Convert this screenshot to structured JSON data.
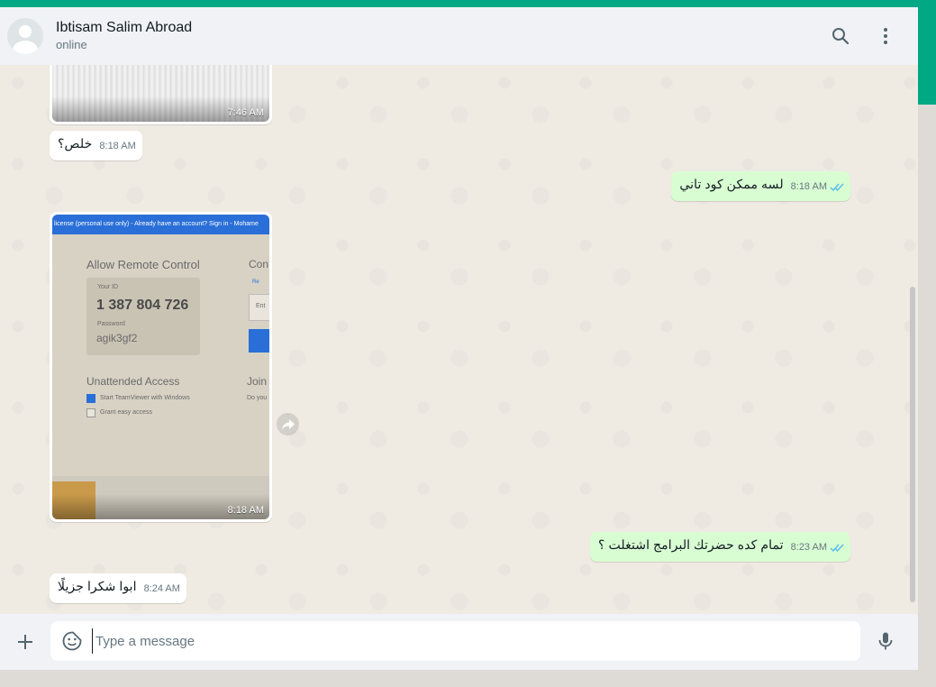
{
  "header": {
    "contact_name": "Ibtisam Salim Abroad",
    "contact_status": "online",
    "icons": [
      "avatar-icon",
      "search-icon",
      "menu-icon"
    ]
  },
  "messages": [
    {
      "type": "image",
      "direction": "incoming",
      "time": "7:46 AM"
    },
    {
      "type": "text",
      "direction": "incoming",
      "text": "خلص؟",
      "time": "8:18 AM"
    },
    {
      "type": "text",
      "direction": "outgoing",
      "text": "لسه ممكن كود تاني",
      "time": "8:18 AM",
      "status": "read"
    },
    {
      "type": "image",
      "direction": "incoming",
      "time": "8:18 AM",
      "image_text": {
        "banner": "license (personal use only) - Already have an account? Sign in - Mohame",
        "heading": "Allow Remote Control",
        "your_id_label": "Your ID",
        "your_id": "1 387 804 726",
        "password_label": "Password",
        "password": "agik3gf2",
        "unattended_heading": "Unattended Access",
        "option_1": "Start TeamViewer with Windows",
        "option_2": "Grant easy access",
        "right_heading": "Con",
        "right_join": "Join",
        "right_do": "Do you",
        "right_re": "Re",
        "right_en": "Ent"
      }
    },
    {
      "type": "text",
      "direction": "outgoing",
      "text": "تمام كده حضرتك البرامج اشتغلت ؟",
      "time": "8:23 AM",
      "status": "read"
    },
    {
      "type": "text",
      "direction": "incoming",
      "text": "ابوا شكرا جزيلًا",
      "time": "8:24 AM"
    }
  ],
  "composer": {
    "placeholder": "Type a message",
    "icons": [
      "plus-icon",
      "sticker-icon",
      "mic-icon"
    ]
  },
  "colors": {
    "accent": "#00a884",
    "incoming_bubble": "#ffffff",
    "outgoing_bubble": "#d9fdd3",
    "read_tick": "#53bdeb",
    "chat_bg": "#efeae2"
  }
}
